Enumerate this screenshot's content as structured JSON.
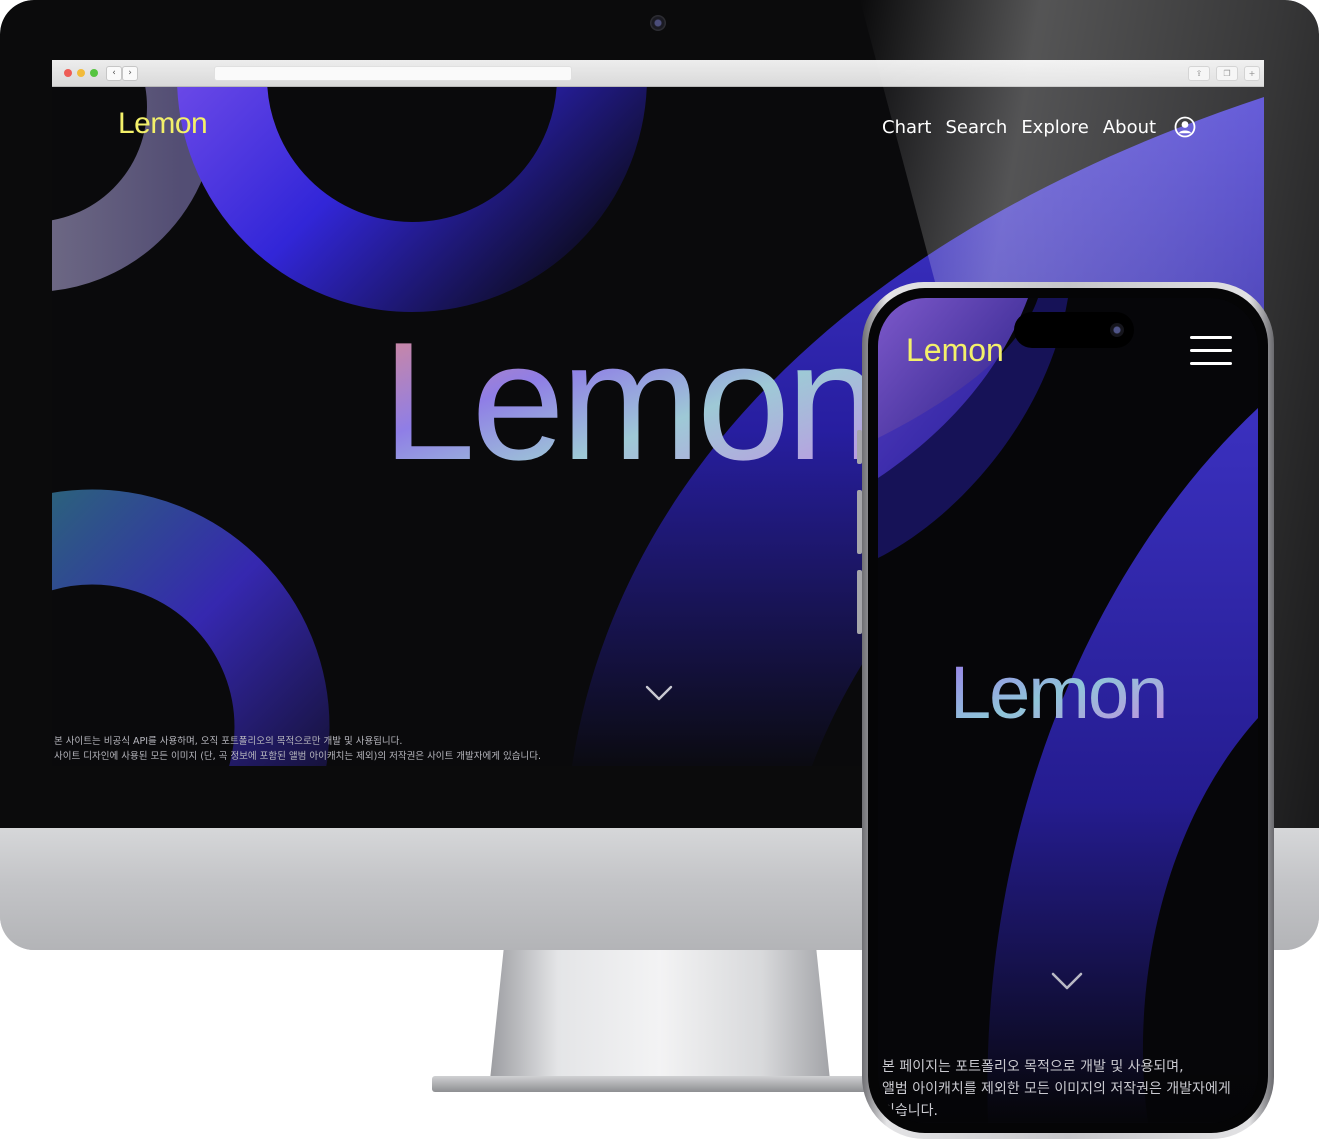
{
  "desktop": {
    "logo": "Lemon",
    "nav": [
      "Chart",
      "Search",
      "Explore",
      "About"
    ],
    "hero_logo": "Lemon",
    "footer_lines": [
      "본 사이트는 비공식 API를 사용하며, 오직 포트폴리오의 목적으로만 개발 및 사용됩니다.",
      "사이트 디자인에 사용된 모든 이미지 (단, 곡 정보에 포함된 앨범 아이캐치는 제외)의 저작권은 사이트 개발자에게 있습니다."
    ]
  },
  "mobile": {
    "logo": "Lemon",
    "hero_logo": "Lemon",
    "footer_lines": [
      "본 페이지는 포트폴리오 목적으로 개발 및 사용되며,",
      "앨범 아이캐치를 제외한 모든 이미지의 저작권은 개발자에게",
      "있습니다."
    ]
  },
  "colors": {
    "logo_yellow": "#f3f06a",
    "background": "#0a0a0c",
    "accent_blue": "#3b2fd8",
    "accent_purple": "#8a62d8"
  },
  "icons": {
    "user": "user-circle-icon",
    "menu": "hamburger-icon",
    "scroll": "chevron-down-icon"
  }
}
